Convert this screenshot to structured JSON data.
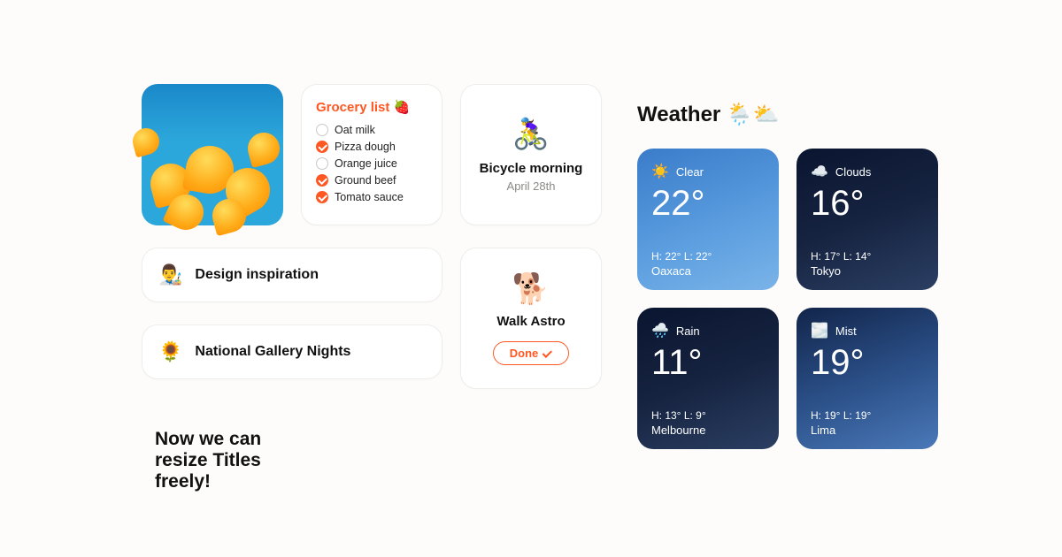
{
  "grocery": {
    "title": "Grocery list 🍓",
    "items": [
      {
        "label": "Oat milk",
        "done": false
      },
      {
        "label": "Pizza dough",
        "done": true
      },
      {
        "label": "Orange juice",
        "done": false
      },
      {
        "label": "Ground beef",
        "done": true
      },
      {
        "label": "Tomato sauce",
        "done": true
      }
    ]
  },
  "bike": {
    "emoji": "🚴‍♀️",
    "title": "Bicycle morning",
    "date": "April 28th"
  },
  "rows": [
    {
      "emoji": "👨‍🎨",
      "label": "Design inspiration"
    },
    {
      "emoji": "🌻",
      "label": "National Gallery Nights"
    }
  ],
  "astro": {
    "emoji": "🐕",
    "title": "Walk Astro",
    "button": "Done"
  },
  "caption": "Now we can resize Titles freely!",
  "weather": {
    "title": "Weather 🌦️⛅",
    "cards": [
      {
        "icon": "☀️",
        "cond": "Clear",
        "temp": "22°",
        "hl": "H: 22° L: 22°",
        "city": "Oaxaca",
        "tone": "light"
      },
      {
        "icon": "☁️",
        "cond": "Clouds",
        "temp": "16°",
        "hl": "H: 17° L: 14°",
        "city": "Tokyo",
        "tone": "dark"
      },
      {
        "icon": "🌧️",
        "cond": "Rain",
        "temp": "11°",
        "hl": "H: 13° L: 9°",
        "city": "Melbourne",
        "tone": "dark"
      },
      {
        "icon": "🌫️",
        "cond": "Mist",
        "temp": "19°",
        "hl": "H: 19° L: 19°",
        "city": "Lima",
        "tone": "mid"
      }
    ]
  }
}
